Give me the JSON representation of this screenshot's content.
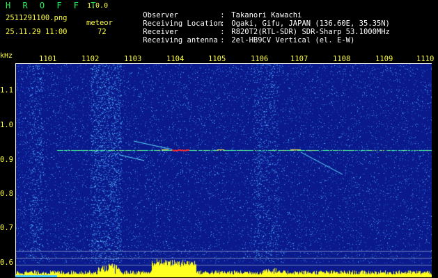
{
  "header": {
    "app_title": "H R O F F T",
    "app_version": "1.0.0",
    "filename": "2511291100.png",
    "datetime": "25.11.29 11:00",
    "meteor_label": "meteor",
    "meteor_count": "72"
  },
  "info": [
    {
      "key": "Observer",
      "colon": ":",
      "value": "Takanori Kawachi"
    },
    {
      "key": "Receiving Location",
      "colon": ":",
      "value": "Ogaki, Gifu, JAPAN (136.60E, 35.35N)"
    },
    {
      "key": "Receiver",
      "colon": ":",
      "value": "R820T2(RTL-SDR) SDR-Sharp 53.1000MHz"
    },
    {
      "key": "Receiving antenna",
      "colon": ":",
      "value": "2el-HB9CV Vertical (el. E-W)"
    }
  ],
  "axes": {
    "y_unit": "kHz",
    "x_ticks": [
      "1101",
      "1102",
      "1103",
      "1104",
      "1105",
      "1106",
      "1107",
      "1108",
      "1109",
      "1110"
    ],
    "y_ticks": [
      "1.1",
      "1.0",
      "0.9",
      "0.8",
      "0.7",
      "0.6"
    ]
  },
  "colors": {
    "background": "#0a1a8c",
    "noise": "#3aa0ff",
    "signal": "#40ffa0",
    "hot": "#ff3030",
    "power_bar": "#ffff20",
    "text_yellow": "#ffff40",
    "title_green": "#28f050"
  }
}
